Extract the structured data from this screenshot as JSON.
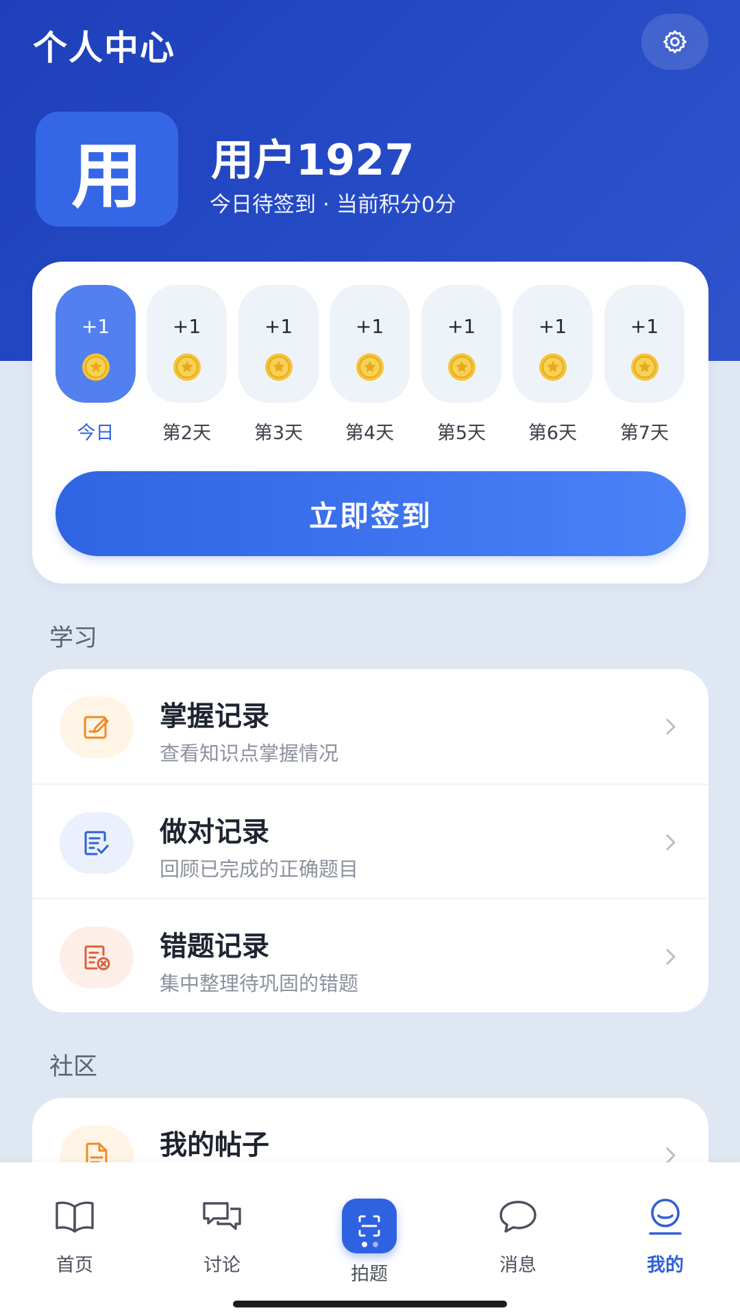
{
  "header": {
    "title": "个人中心",
    "settings_icon": "gear-icon"
  },
  "user": {
    "avatar_text": "用",
    "name": "用户1927",
    "checkin_status": "今日待签到",
    "separator": "·",
    "points_text": "当前积分0分"
  },
  "checkin": {
    "days": [
      {
        "reward": "+1",
        "label": "今日",
        "active": true
      },
      {
        "reward": "+1",
        "label": "第2天",
        "active": false
      },
      {
        "reward": "+1",
        "label": "第3天",
        "active": false
      },
      {
        "reward": "+1",
        "label": "第4天",
        "active": false
      },
      {
        "reward": "+1",
        "label": "第5天",
        "active": false
      },
      {
        "reward": "+1",
        "label": "第6天",
        "active": false
      },
      {
        "reward": "+1",
        "label": "第7天",
        "active": false
      }
    ],
    "button_label": "立即签到"
  },
  "sections": {
    "study": {
      "title": "学习",
      "items": [
        {
          "title": "掌握记录",
          "subtitle": "查看知识点掌握情况",
          "icon": "edit-note-icon"
        },
        {
          "title": "做对记录",
          "subtitle": "回顾已完成的正确题目",
          "icon": "checklist-icon"
        },
        {
          "title": "错题记录",
          "subtitle": "集中整理待巩固的错题",
          "icon": "wrong-list-icon"
        }
      ]
    },
    "community": {
      "title": "社区",
      "items": [
        {
          "title": "我的帖子",
          "icon": "document-icon"
        }
      ]
    }
  },
  "nav": {
    "items": [
      {
        "label": "首页",
        "icon": "book-icon"
      },
      {
        "label": "讨论",
        "icon": "chat-bubbles-icon"
      },
      {
        "label": "拍题",
        "icon": "scan-icon"
      },
      {
        "label": "消息",
        "icon": "message-icon"
      },
      {
        "label": "我的",
        "icon": "profile-icon"
      }
    ],
    "active_index": 4
  },
  "colors": {
    "header_blue": "#2449c4",
    "accent_blue": "#2f64e3",
    "active_day": "#5280ee",
    "coin_gold": "#f5c437"
  }
}
